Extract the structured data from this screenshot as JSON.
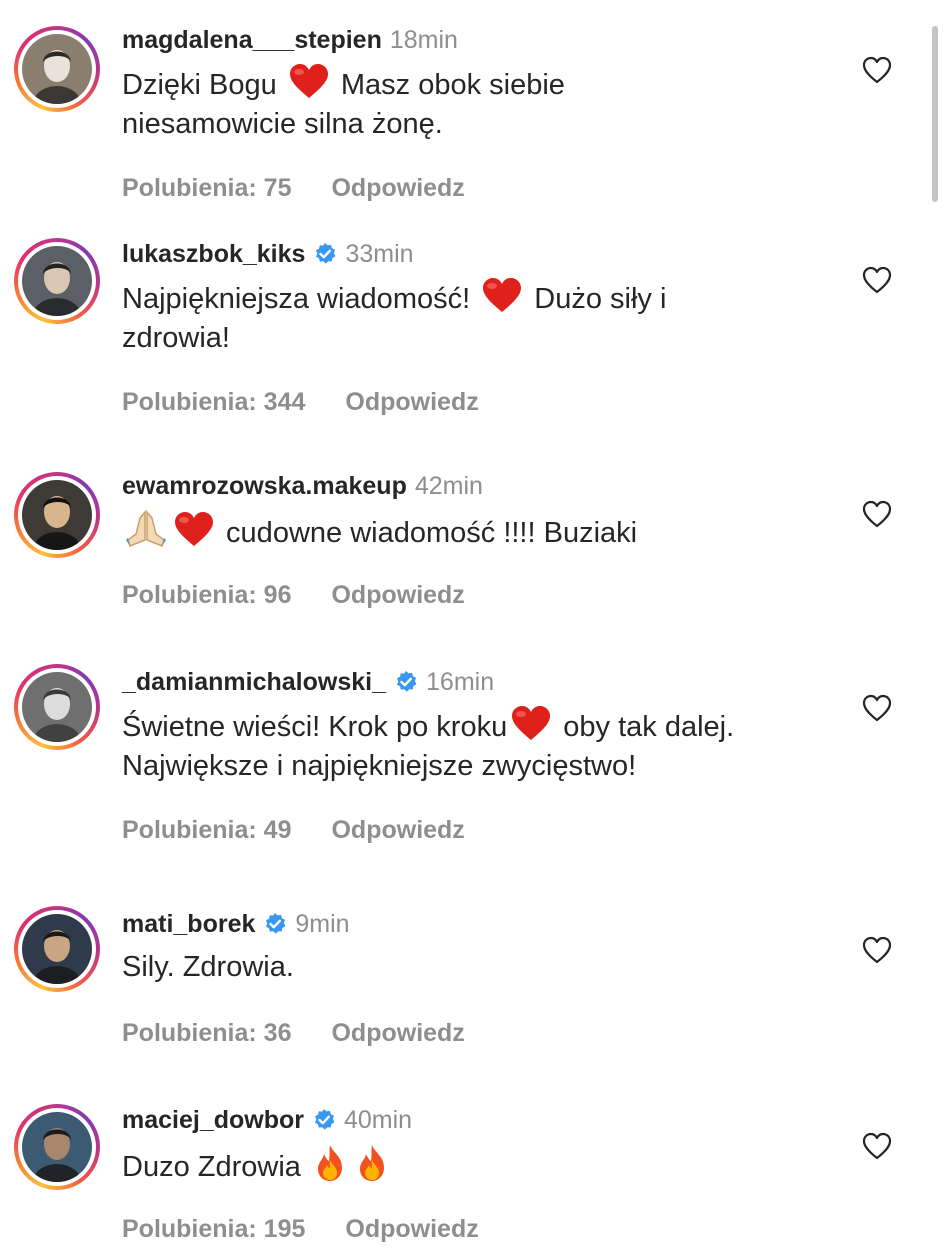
{
  "comments": [
    {
      "username": "magdalena___stepien",
      "verified": false,
      "time": "18min",
      "lines": [
        {
          "a": "Dzięki Bogu ",
          "emoji": "heart",
          "b": " Masz obok siebie"
        },
        {
          "a": "niesamowicie silna żonę."
        }
      ],
      "likes": "Polubienia: 75",
      "reply": "Odpowiedz"
    },
    {
      "username": "lukaszbok_kiks",
      "verified": true,
      "time": "33min",
      "lines": [
        {
          "a": "Najpiękniejsza wiadomość! ",
          "emoji": "heart",
          "b": " Dużo siły i"
        },
        {
          "a": "zdrowia!"
        }
      ],
      "likes": "Polubienia: 344",
      "reply": "Odpowiedz"
    },
    {
      "username": "ewamrozowska.makeup",
      "verified": false,
      "time": "42min",
      "lines": [
        {
          "emoji": "pray-heart",
          "b": " cudowne wiadomość !!!! Buziaki"
        }
      ],
      "likes": "Polubienia: 96",
      "reply": "Odpowiedz"
    },
    {
      "username": "_damianmichalowski_",
      "verified": true,
      "time": "16min",
      "lines": [
        {
          "a": "Świetne wieści! Krok po kroku",
          "emoji": "heart",
          "b": " oby tak dalej."
        },
        {
          "a": "Największe i najpiękniejsze zwycięstwo!"
        }
      ],
      "likes": "Polubienia: 49",
      "reply": "Odpowiedz"
    },
    {
      "username": "mati_borek",
      "verified": true,
      "time": "9min",
      "lines": [
        {
          "a": "Sily. Zdrowia."
        }
      ],
      "likes": "Polubienia: 36",
      "reply": "Odpowiedz"
    },
    {
      "username": "maciej_dowbor",
      "verified": true,
      "time": "40min",
      "lines": [
        {
          "a": "Duzo Zdrowia ",
          "emoji": "fire-fire"
        }
      ],
      "likes": "Polubienia: 195",
      "reply": "Odpowiedz"
    }
  ],
  "icons": {
    "like": "heart-outline-icon",
    "verified": "verified-badge-icon"
  },
  "colors": {
    "text": "#262626",
    "muted": "#8e8e8e",
    "verified": "#3897f0",
    "emoji_heart": "#e0201b"
  }
}
